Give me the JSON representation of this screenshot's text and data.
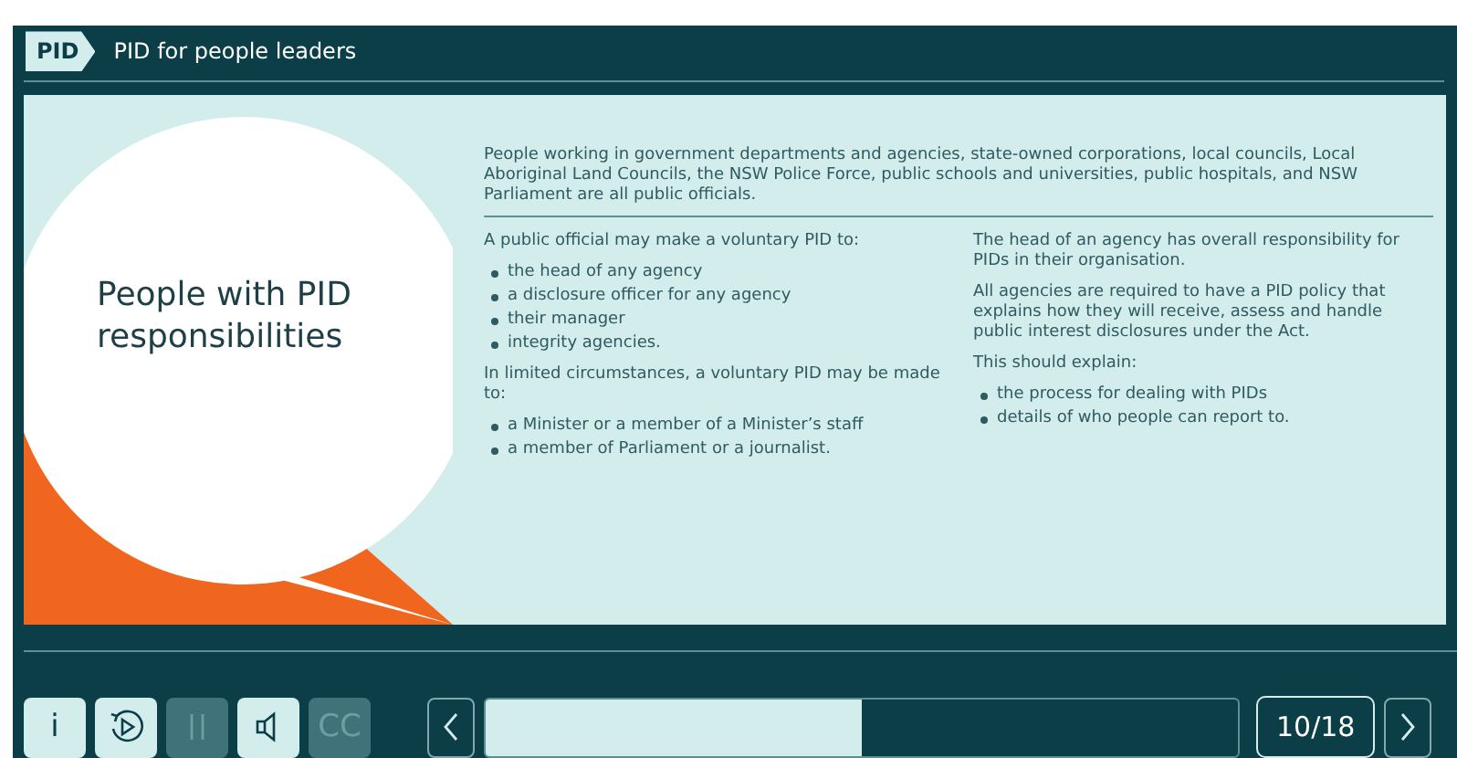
{
  "header": {
    "badge": "PID",
    "title": "PID for people leaders"
  },
  "slide": {
    "heading": "People with PID responsibilities",
    "intro": "People working in government departments and agencies, state-owned corporations, local councils, Local Aboriginal Land Councils, the NSW Police Force, public schools and universities, public hospitals, and NSW Parliament are all public officials.",
    "columns": [
      {
        "blocks": [
          {
            "kind": "text",
            "text": "A public official may make a voluntary PID to:"
          },
          {
            "kind": "list",
            "items": [
              "the head of any agency",
              "a disclosure officer for any agency",
              "their manager",
              "integrity agencies."
            ]
          },
          {
            "kind": "text",
            "text": "In limited circumstances, a voluntary PID may be made to:"
          },
          {
            "kind": "list",
            "items": [
              "a Minister or a member of a Minister’s staff",
              "a member of Parliament or a journalist."
            ]
          }
        ]
      },
      {
        "blocks": [
          {
            "kind": "text",
            "text": "The head of an agency has overall responsibility for PIDs in their organisation."
          },
          {
            "kind": "text",
            "text": "All agencies are required to have a PID policy that explains how they will receive, assess and handle public interest disclosures under the Act."
          },
          {
            "kind": "text",
            "text": "This should explain:"
          },
          {
            "kind": "list",
            "items": [
              "the process for dealing with PIDs",
              "details of who people can report to."
            ]
          }
        ]
      }
    ]
  },
  "controls": [
    {
      "kind": "info",
      "label": "i",
      "disabled": false
    },
    {
      "kind": "replay",
      "disabled": false
    },
    {
      "kind": "pause",
      "disabled": true
    },
    {
      "kind": "sound",
      "disabled": false
    },
    {
      "kind": "captions",
      "label": "CC",
      "disabled": true
    }
  ],
  "progress": {
    "level": 0.5,
    "counter": "10/18"
  }
}
